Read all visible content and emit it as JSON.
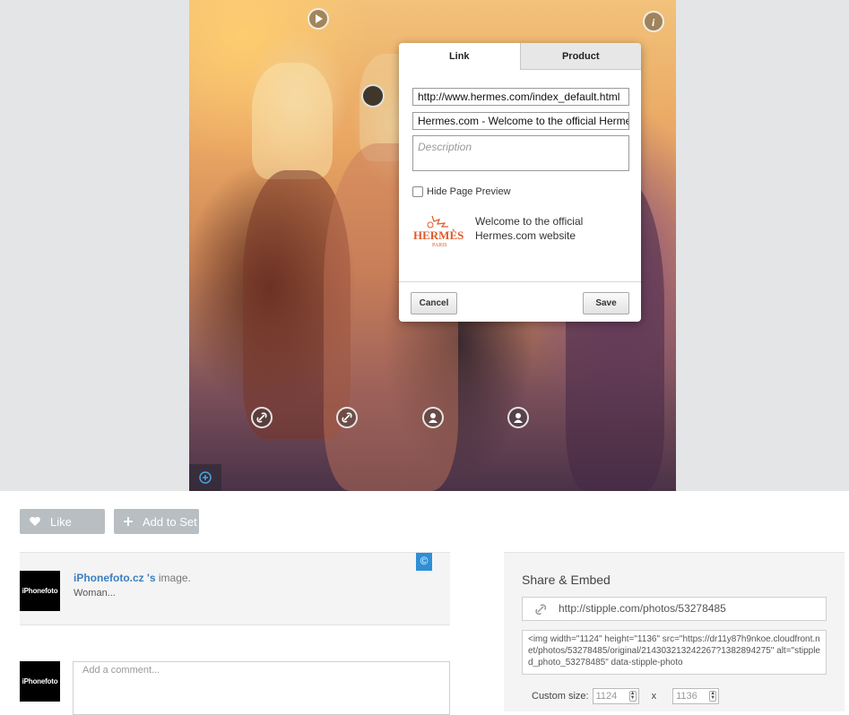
{
  "popup": {
    "tabs": [
      {
        "label": "Link",
        "active": true
      },
      {
        "label": "Product",
        "active": false
      }
    ],
    "url_value": "http://www.hermes.com/index_default.html",
    "title_value": "Hermes.com - Welcome to the official Hermes.com website",
    "description_placeholder": "Description",
    "hide_preview_label": "Hide Page Preview",
    "hide_preview_checked": false,
    "preview_logo_text": "HERMÈS",
    "preview_logo_subtext": "PARIS",
    "preview_text": "Welcome to the official Hermes.com website",
    "cancel_label": "Cancel",
    "save_label": "Save"
  },
  "actions": {
    "like_label": "Like",
    "add_to_set_label": "Add to Set"
  },
  "image_info": {
    "avatar_text": "iPhonefoto",
    "owner": "iPhonefoto.cz 's",
    "suffix": " image.",
    "caption": "Woman...",
    "copyright_symbol": "©"
  },
  "comment": {
    "avatar_text": "iPhonefoto",
    "placeholder": "Add a comment..."
  },
  "share": {
    "title": "Share & Embed",
    "link": "http://stipple.com/photos/53278485",
    "embed_code": "<img width=\"1124\" height=\"1136\" src=\"https://dr11y87h9nkoe.cloudfront.net/photos/53278485/original/214303213242267?1382894275\" alt=\"stippled_photo_53278485\" data-stipple-photo",
    "custom_size_label": "Custom size:",
    "width_value": "1124",
    "times": "x",
    "height_value": "1136"
  },
  "colors": {
    "accent_blue": "#3a7fc1",
    "button_gray": "#b8bec2",
    "ribbon_blue": "#2d8fd5"
  }
}
